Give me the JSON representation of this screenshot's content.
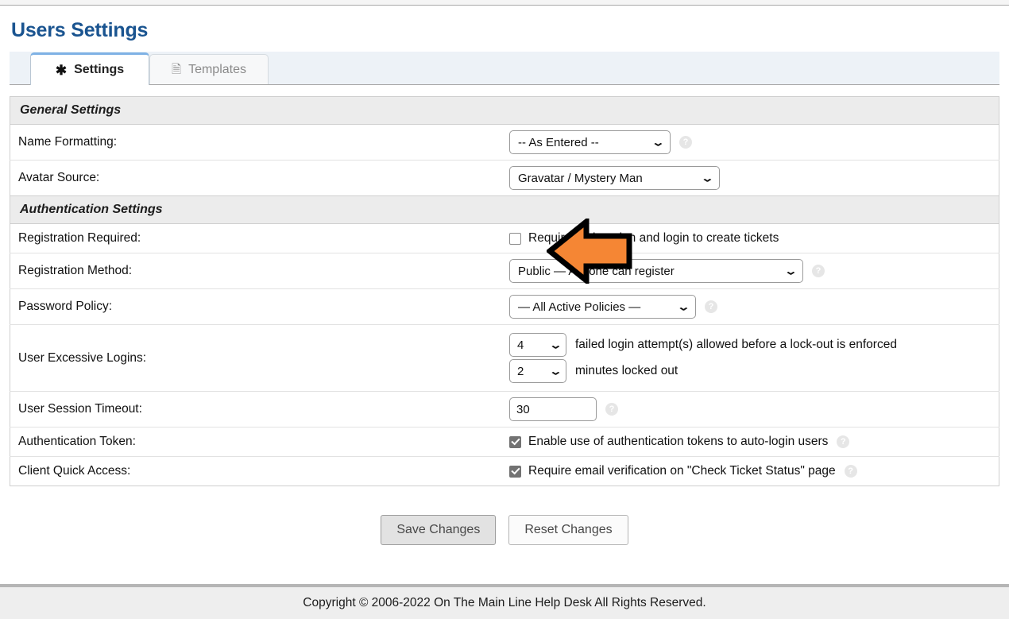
{
  "page": {
    "title": "Users Settings"
  },
  "tabs": [
    {
      "label": "Settings",
      "icon": "asterisk-icon",
      "glyph": "✱",
      "active": true
    },
    {
      "label": "Templates",
      "icon": "document-icon",
      "glyph": "🗎",
      "active": false
    }
  ],
  "sections": [
    {
      "title": "General Settings",
      "rows": [
        {
          "label": "Name Formatting:",
          "control": "select",
          "value": "-- As Entered --",
          "help": true
        },
        {
          "label": "Avatar Source:",
          "control": "select",
          "value": "Gravatar / Mystery Man",
          "help": false
        }
      ]
    },
    {
      "title": "Authentication Settings",
      "rows": [
        {
          "label": "Registration Required:",
          "control": "checkbox",
          "checked": false,
          "text": "Require registration and login to create tickets",
          "help": false
        },
        {
          "label": "Registration Method:",
          "control": "select",
          "value": "Public — Anyone can register",
          "help": true
        },
        {
          "label": "Password Policy:",
          "control": "select",
          "value": "— All Active Policies —",
          "help": true
        },
        {
          "label": "User Excessive Logins:",
          "control": "dual-select",
          "value1": "4",
          "text1": "failed login attempt(s) allowed before a lock-out is enforced",
          "value2": "2",
          "text2": "minutes locked out"
        },
        {
          "label": "User Session Timeout:",
          "control": "text",
          "value": "30",
          "help": true
        },
        {
          "label": "Authentication Token:",
          "control": "checkbox",
          "checked": true,
          "text": "Enable use of authentication tokens to auto-login users",
          "help": true
        },
        {
          "label": "Client Quick Access:",
          "control": "checkbox",
          "checked": true,
          "text": "Require email verification on \"Check Ticket Status\" page",
          "help": true
        }
      ]
    }
  ],
  "buttons": {
    "save": "Save Changes",
    "reset": "Reset Changes"
  },
  "footer": {
    "copyright": "Copyright © 2006-2022 On The Main Line Help Desk All Rights Reserved."
  },
  "annotation": {
    "type": "left-arrow",
    "color": "#F58634",
    "outline": "#000000"
  },
  "help_glyph": "?"
}
